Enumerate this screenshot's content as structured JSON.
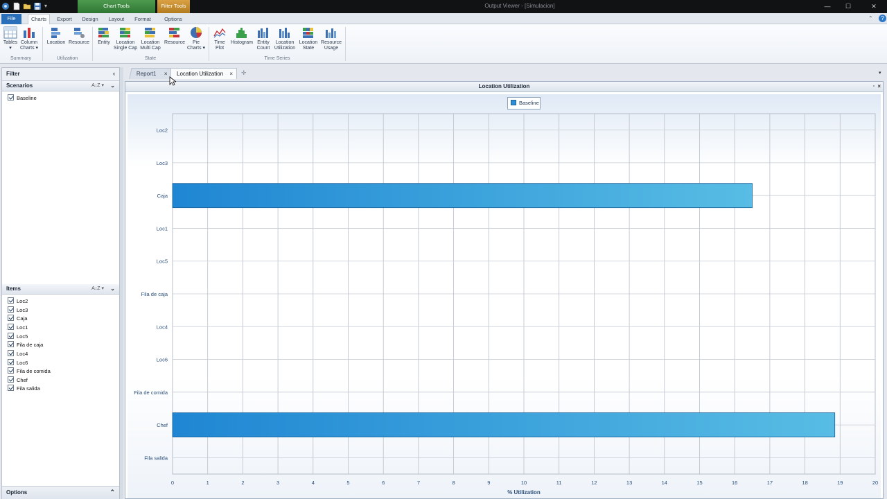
{
  "window": {
    "title": "Output Viewer - [Simulacion]"
  },
  "context_tabs": {
    "chart_tools": "Chart Tools",
    "filter_tools": "Filter Tools"
  },
  "ribbon_tabs": [
    "File",
    "Charts",
    "Export",
    "Design",
    "Layout",
    "Format",
    "Options"
  ],
  "ribbon": {
    "summary": {
      "label": "Summary",
      "tables": "Tables",
      "column_charts_1": "Column",
      "column_charts_2": "Charts"
    },
    "utilization": {
      "label": "Utilization",
      "location": "Location",
      "resource": "Resource"
    },
    "state": {
      "label": "State",
      "entity": "Entity",
      "loc_single_1": "Location",
      "loc_single_2": "Single Cap",
      "loc_multi_1": "Location",
      "loc_multi_2": "Multi Cap",
      "resource": "Resource",
      "pie_1": "Pie",
      "pie_2": "Charts"
    },
    "time_series": {
      "label": "Time Series",
      "time_plot_1": "Time",
      "time_plot_2": "Plot",
      "histogram": "Histogram",
      "entity_count_1": "Entity",
      "entity_count_2": "Count",
      "loc_util_1": "Location",
      "loc_util_2": "Utilization",
      "loc_state_1": "Location",
      "loc_state_2": "State",
      "res_usage_1": "Resource",
      "res_usage_2": "Usage"
    }
  },
  "filter_pane": {
    "title": "Filter",
    "scenarios_title": "Scenarios",
    "scenarios": [
      "Baseline"
    ],
    "items_title": "Items",
    "items": [
      "Loc2",
      "Loc3",
      "Caja",
      "Loc1",
      "Loc5",
      "Fila de caja",
      "Loc4",
      "Loc6",
      "Fila de comida",
      "Chef",
      "Fila salida"
    ],
    "options_title": "Options"
  },
  "doc_tabs": {
    "report": "Report1",
    "active": "Location Utilization"
  },
  "chart_panel": {
    "title": "Location Utilization"
  },
  "colors": {
    "bar_start": "#1f86d3",
    "bar_end": "#58bde4",
    "accent": "#2a6fb9"
  },
  "chart_data": {
    "type": "bar",
    "orientation": "horizontal",
    "title": "Location Utilization",
    "categories": [
      "Loc2",
      "Loc3",
      "Caja",
      "Loc1",
      "Loc5",
      "Fila de caja",
      "Loc4",
      "Loc6",
      "Fila de comida",
      "Chef",
      "Fila salida"
    ],
    "series": [
      {
        "name": "Baseline",
        "values": [
          0,
          0,
          16.5,
          0,
          0,
          0,
          0,
          0,
          0,
          18.85,
          0
        ]
      }
    ],
    "xlabel": "% Utilization",
    "ylabel": "",
    "xlim": [
      0,
      20
    ],
    "xticks": [
      0,
      1,
      2,
      3,
      4,
      5,
      6,
      7,
      8,
      9,
      10,
      11,
      12,
      13,
      14,
      15,
      16,
      17,
      18,
      19,
      20
    ],
    "grid": true,
    "legend": "top-center"
  }
}
